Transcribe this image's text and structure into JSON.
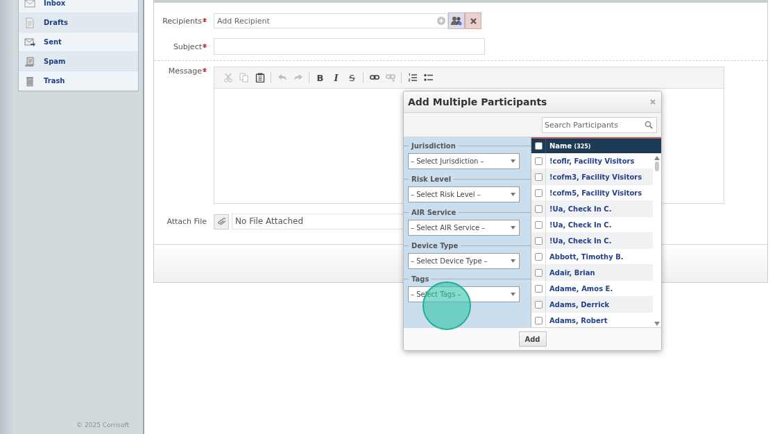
{
  "sidebar": {
    "items": [
      {
        "label": "Inbox",
        "kind": "inbox"
      },
      {
        "label": "Drafts",
        "kind": "drafts"
      },
      {
        "label": "Sent",
        "kind": "sent"
      },
      {
        "label": "Spam",
        "kind": "spam"
      },
      {
        "label": "Trash",
        "kind": "trash"
      }
    ],
    "copyright": "© 2025 Corrisoft"
  },
  "form": {
    "recipients": {
      "label": "Recipients",
      "required": true,
      "placeholder": "Add Recipient"
    },
    "subject": {
      "label": "Subject",
      "required": true
    },
    "message": {
      "label": "Message",
      "required": true,
      "toolbar": [
        [
          {
            "kind": "cut",
            "disabled": true
          },
          {
            "kind": "copy",
            "disabled": true
          },
          {
            "kind": "paste",
            "disabled": false
          }
        ],
        [
          {
            "kind": "undo",
            "disabled": true
          },
          {
            "kind": "redo",
            "disabled": true
          }
        ],
        [
          {
            "kind": "bold",
            "label": "B",
            "disabled": false
          },
          {
            "kind": "italic",
            "label": "I",
            "disabled": false
          },
          {
            "kind": "strike",
            "label": "S",
            "disabled": false
          }
        ],
        [
          {
            "kind": "link",
            "disabled": false
          },
          {
            "kind": "unlink",
            "disabled": true
          }
        ],
        [
          {
            "kind": "numbered",
            "disabled": false
          },
          {
            "kind": "bulleted",
            "disabled": false
          }
        ]
      ]
    },
    "attach": {
      "label": "Attach File",
      "value": "No File Attached"
    }
  },
  "dialog": {
    "title": "Add Multiple Participants",
    "search": {
      "placeholder": "Search Participants"
    },
    "filters": [
      {
        "label": "Jurisdiction",
        "placeholder": "– Select Jurisdiction –"
      },
      {
        "label": "Risk Level",
        "placeholder": "– Select Risk Level –"
      },
      {
        "label": "AIR Service",
        "placeholder": "– Select AIR Service –"
      },
      {
        "label": "Device Type",
        "placeholder": "– Select Device Type –"
      },
      {
        "label": "Tags",
        "placeholder": "– Select Tags –"
      }
    ],
    "table": {
      "header": {
        "label": "Name",
        "count": "(325)",
        "checked": false
      },
      "rows": [
        {
          "name": "!coflr, Facility Visitors",
          "checked": false
        },
        {
          "name": "!cofm3, Facility Visitors",
          "checked": false
        },
        {
          "name": "!cofm5, Facility Visitors",
          "checked": false
        },
        {
          "name": "!Ua, Check In C.",
          "checked": false
        },
        {
          "name": "!Ua, Check In C.",
          "checked": false
        },
        {
          "name": "!Ua, Check In C.",
          "checked": false
        },
        {
          "name": "Abbott, Timothy B.",
          "checked": false
        },
        {
          "name": "Adair, Brian",
          "checked": false
        },
        {
          "name": "Adame, Amos E.",
          "checked": false
        },
        {
          "name": "Adams, Derrick",
          "checked": false
        },
        {
          "name": "Adams, Robert",
          "checked": false
        }
      ]
    },
    "button": "Add"
  }
}
